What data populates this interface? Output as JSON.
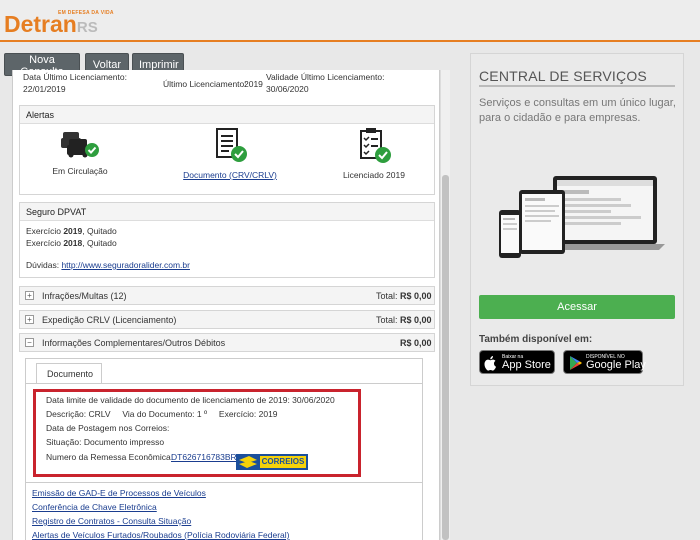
{
  "header": {
    "logo_tagline": "EM DEFESA DA VIDA",
    "logo_main": "Detran",
    "logo_suffix": "RS"
  },
  "toolbar": {
    "new_query": "Nova Consulta",
    "back": "Voltar",
    "print": "Imprimir"
  },
  "licensing": {
    "last_date_label": "Data Último Licenciamento:",
    "last_date": "22/01/2019",
    "last_year_label": "Último Licenciamento:",
    "last_year": "2019",
    "validity_label": "Validade Último Licenciamento:",
    "validity": "30/06/2020"
  },
  "alerts": {
    "title": "Alertas",
    "items": [
      {
        "label": "Em Circulação",
        "icon": "car-check-icon"
      },
      {
        "label": "Documento (CRV/CRLV)",
        "icon": "document-check-icon",
        "link": true
      },
      {
        "label": "Licenciado 2019",
        "icon": "clipboard-check-icon"
      }
    ]
  },
  "dpvat": {
    "title": "Seguro DPVAT",
    "line1_prefix": "Exercício ",
    "line1_year": "2019",
    "line1_status": ", Quitado",
    "line2_prefix": "Exercício ",
    "line2_year": "2018",
    "line2_status": ", Quitado",
    "doubts_label": "Dúvidas: ",
    "doubts_link": "http://www.seguradoralider.com.br"
  },
  "rows": [
    {
      "label": "Infrações/Multas (12)",
      "total_label": "Total:",
      "value": "R$ 0,00",
      "symbol": "+"
    },
    {
      "label": "Expedição CRLV (Licenciamento)",
      "total_label": "Total:",
      "value": "R$ 0,00",
      "symbol": "+"
    },
    {
      "label": "Informações Complementares/Outros Débitos",
      "total_label": "",
      "value": "R$ 0,00",
      "symbol": "−"
    }
  ],
  "document": {
    "tab": "Documento",
    "validity_line": "Data limite de validade do documento de licenciamento de 2019: 30/06/2020",
    "desc_label": "Descrição:",
    "desc_value": "CRLV",
    "via_label": "Via do Documento:",
    "via_value": "1 º",
    "exercise_label": "Exercício:",
    "exercise_value": "2019",
    "posting_label": "Data de Postagem nos Correios:",
    "status_label": "Situação:",
    "status_value": "Documento impresso",
    "remessa_label": "Numero da Remessa Econômica:",
    "remessa_value": "DT626716783BR",
    "correios_logo": "CORREIOS"
  },
  "links": [
    "Emissão de GAD-E de Processos de Veículos",
    "Conferência de Chave Eletrônica",
    "Registro de Contratos - Consulta Situação",
    "Alertas de Veículos Furtados/Roubados (Polícia Rodoviária Federal)"
  ],
  "sidebar": {
    "title": "CENTRAL DE SERVIÇOS",
    "desc": "Serviços e consultas em um único lugar, para o cidadão e para empresas.",
    "access_button": "Acessar",
    "available": "Também disponível em:",
    "appstore_small": "Baixar na",
    "appstore_big": "App Store",
    "googleplay_small": "DISPONÍVEL NO",
    "googleplay_big": "Google Play"
  },
  "colors": {
    "brand_orange": "#e67e22",
    "button_gray": "#5d6569",
    "success_green": "#4caf50",
    "alert_red": "#c9232d"
  }
}
